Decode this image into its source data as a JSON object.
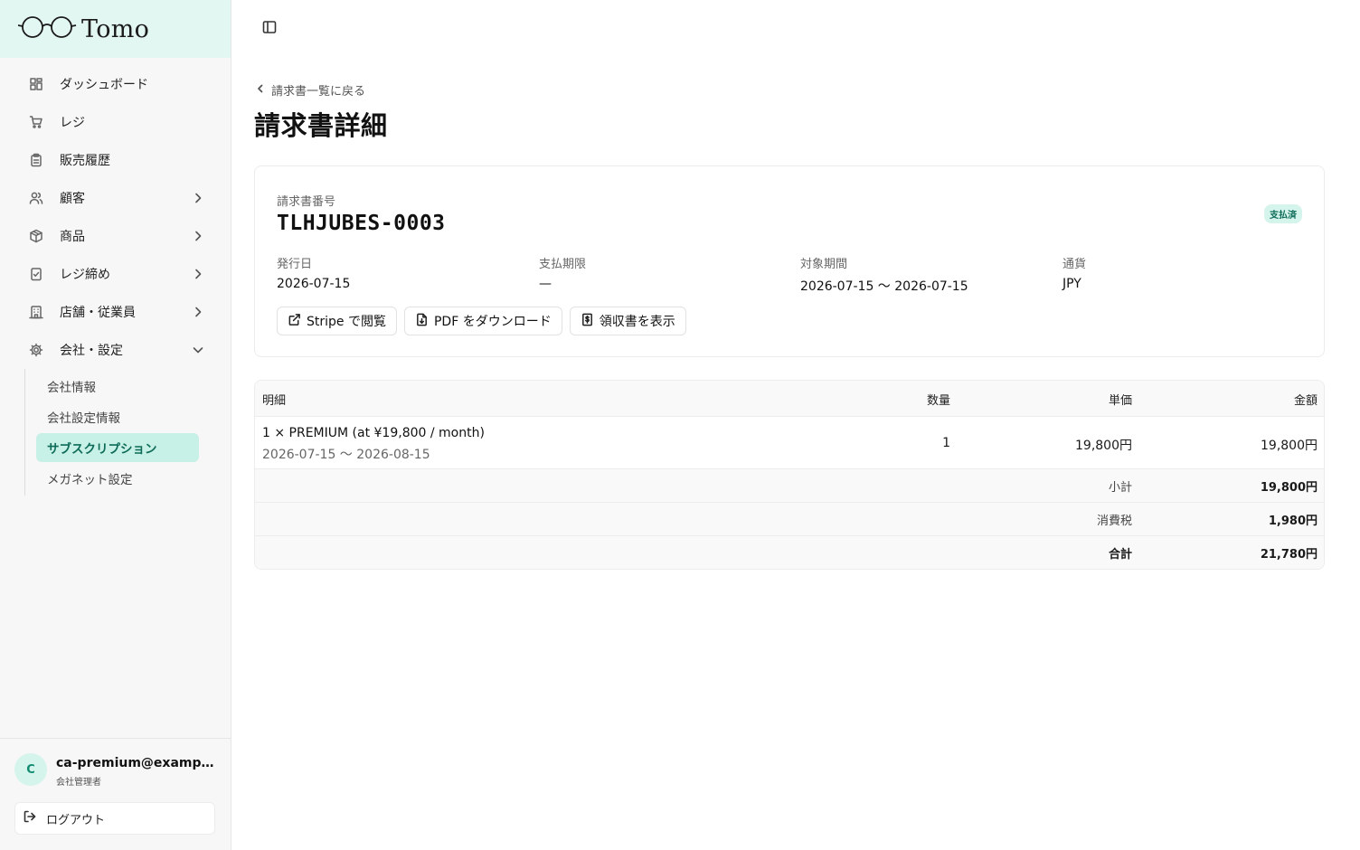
{
  "app": {
    "name": "Tomo"
  },
  "sidebar": {
    "items": [
      {
        "label": "ダッシュボード",
        "icon": "dashboard-icon"
      },
      {
        "label": "レジ",
        "icon": "cart-icon"
      },
      {
        "label": "販売履歴",
        "icon": "clipboard-icon"
      },
      {
        "label": "顧客",
        "icon": "users-icon"
      },
      {
        "label": "商品",
        "icon": "box-icon"
      },
      {
        "label": "レジ締め",
        "icon": "checklist-icon"
      },
      {
        "label": "店舗・従業員",
        "icon": "building-icon"
      },
      {
        "label": "会社・設定",
        "icon": "gear-icon"
      }
    ],
    "subitems": [
      {
        "label": "会社情報"
      },
      {
        "label": "会社設定情報"
      },
      {
        "label": "サブスクリプション"
      },
      {
        "label": "メガネット設定"
      }
    ],
    "user": {
      "initial": "C",
      "email": "ca-premium@example.com",
      "role": "会社管理者"
    },
    "logout_label": "ログアウト"
  },
  "main": {
    "back_label": "請求書一覧に戻る",
    "title": "請求書詳細",
    "invoice": {
      "number_label": "請求書番号",
      "number": "TLHJUBES-0003",
      "status": "支払済",
      "status_color": "#0d6b58",
      "issue_date_label": "発行日",
      "issue_date": "2026-07-15",
      "due_label": "支払期限",
      "due": "—",
      "period_label": "対象期間",
      "period": "2026-07-15 〜 2026-07-15",
      "currency_label": "通貨",
      "currency": "JPY"
    },
    "actions": {
      "stripe": "Stripe で閲覧",
      "pdf": "PDF をダウンロード",
      "receipt": "領収書を表示"
    },
    "table": {
      "headers": {
        "desc": "明細",
        "qty": "数量",
        "unit": "単価",
        "amount": "金額"
      },
      "rows": [
        {
          "desc": "1 × PREMIUM (at ¥19,800 / month)",
          "period": "2026-07-15 〜 2026-08-15",
          "qty": "1",
          "unit": "19,800円",
          "amount": "19,800円"
        }
      ],
      "subtotal_label": "小計",
      "subtotal": "19,800円",
      "tax_label": "消費税",
      "tax": "1,980円",
      "total_label": "合計",
      "total": "21,780円"
    }
  }
}
